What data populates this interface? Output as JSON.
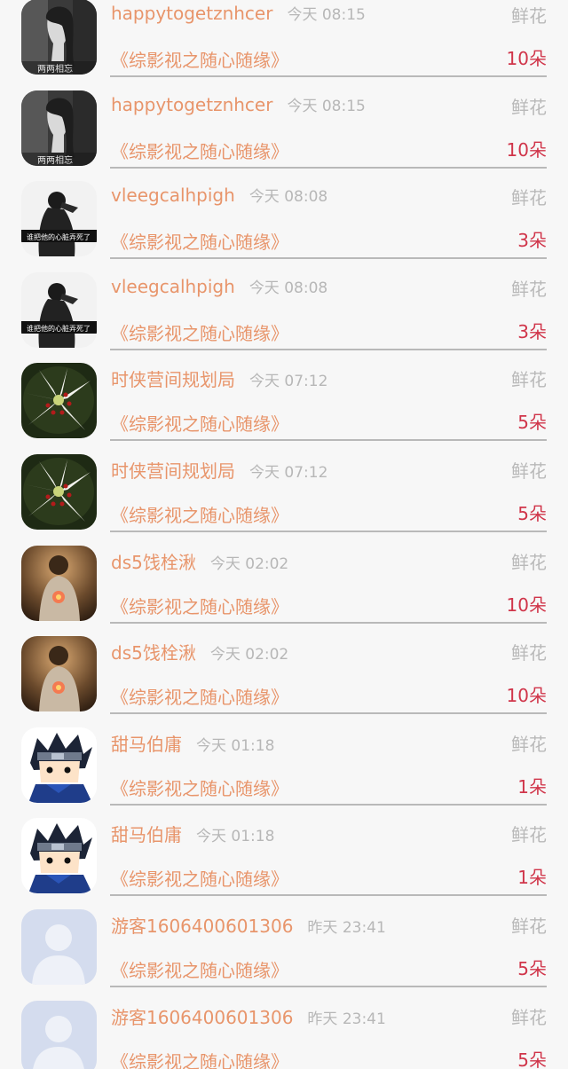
{
  "gift_records": [
    {
      "user": "happytogetznhcer",
      "time": "今天 08:15",
      "gift": "鲜花",
      "book": "《综影视之随心随缘》",
      "count": "10朵",
      "avatar": "bw-portrait-avatar",
      "avatar_caption": "两两相忘"
    },
    {
      "user": "happytogetznhcer",
      "time": "今天 08:15",
      "gift": "鲜花",
      "book": "《综影视之随心随缘》",
      "count": "10朵",
      "avatar": "bw-portrait-avatar",
      "avatar_caption": "两两相忘"
    },
    {
      "user": "vleegcalhpigh",
      "time": "今天 08:08",
      "gift": "鲜花",
      "book": "《综影视之随心随缘》",
      "count": "3朵",
      "avatar": "sad-figure-avatar",
      "avatar_caption": "谁把他的心脏弄死了"
    },
    {
      "user": "vleegcalhpigh",
      "time": "今天 08:08",
      "gift": "鲜花",
      "book": "《综影视之随心随缘》",
      "count": "3朵",
      "avatar": "sad-figure-avatar",
      "avatar_caption": "谁把他的心脏弄死了"
    },
    {
      "user": "时侠营间规划局",
      "time": "今天 07:12",
      "gift": "鲜花",
      "book": "《综影视之随心随缘》",
      "count": "5朵",
      "avatar": "lily-flower-avatar"
    },
    {
      "user": "时侠营间规划局",
      "time": "今天 07:12",
      "gift": "鲜花",
      "book": "《综影视之随心随缘》",
      "count": "5朵",
      "avatar": "lily-flower-avatar"
    },
    {
      "user": "ds5饯栓湫",
      "time": "今天 02:02",
      "gift": "鲜花",
      "book": "《综影视之随心随缘》",
      "count": "10朵",
      "avatar": "warm-light-avatar"
    },
    {
      "user": "ds5饯栓湫",
      "time": "今天 02:02",
      "gift": "鲜花",
      "book": "《综影视之随心随缘》",
      "count": "10朵",
      "avatar": "warm-light-avatar"
    },
    {
      "user": "甜马伯庸",
      "time": "今天 01:18",
      "gift": "鲜花",
      "book": "《综影视之随心随缘》",
      "count": "1朵",
      "avatar": "anime-ninja-avatar"
    },
    {
      "user": "甜马伯庸",
      "time": "今天 01:18",
      "gift": "鲜花",
      "book": "《综影视之随心随缘》",
      "count": "1朵",
      "avatar": "anime-ninja-avatar"
    },
    {
      "user": "游客1606400601306",
      "time": "昨天 23:41",
      "gift": "鲜花",
      "book": "《综影视之随心随缘》",
      "count": "5朵",
      "avatar": "default-user-avatar"
    },
    {
      "user": "游客1606400601306",
      "time": "昨天 23:41",
      "gift": "鲜花",
      "book": "《综影视之随心随缘》",
      "count": "5朵",
      "avatar": "default-user-avatar"
    }
  ],
  "colors": {
    "username": "#e8956b",
    "book_title": "#e8956b",
    "count": "#d0354a",
    "muted": "#b9b9b9",
    "background": "#f7f7f7"
  }
}
